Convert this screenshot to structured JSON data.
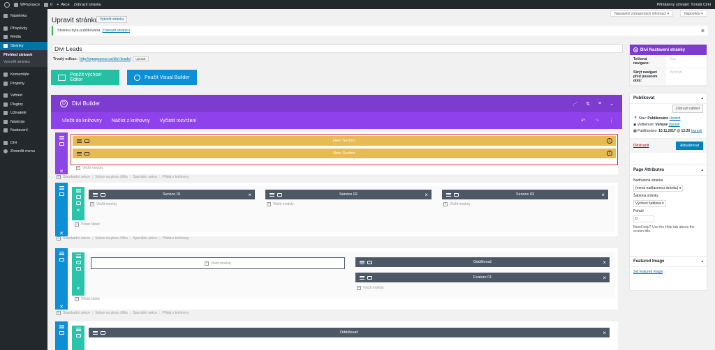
{
  "adminbar": {
    "site_name": "WPspravce",
    "comments_count": "0",
    "new_label": "Akce",
    "view_page": "Zobrazit stránku",
    "user_greeting": "Přihlášený uživatel: Tomáš Cirkl"
  },
  "sidebar": {
    "items": [
      {
        "label": "Nástěnka",
        "icon": "dashboard-icon"
      },
      {
        "label": "Příspěvky",
        "icon": "pin-icon"
      },
      {
        "label": "Média",
        "icon": "media-icon"
      },
      {
        "label": "Stránky",
        "icon": "pages-icon",
        "active": true
      },
      {
        "label": "Komentáře",
        "icon": "comments-icon"
      },
      {
        "label": "Projekty",
        "icon": "pin-icon"
      },
      {
        "label": "Vzhled",
        "icon": "brush-icon"
      },
      {
        "label": "Pluginy",
        "icon": "plugin-icon"
      },
      {
        "label": "Uživatelé",
        "icon": "users-icon"
      },
      {
        "label": "Nástroje",
        "icon": "tools-icon"
      },
      {
        "label": "Nastavení",
        "icon": "settings-icon"
      },
      {
        "label": "Divi",
        "icon": "divi-icon"
      }
    ],
    "sub_items": [
      "Přehled stránek",
      "Vytvořit stránku"
    ],
    "collapse": "Zmenšit menu"
  },
  "header": {
    "screen_options": "Nastavení zobrazených informací",
    "help": "Nápověda",
    "title": "Upravit stránku",
    "add_new": "Vytvořit stránku"
  },
  "notice": {
    "text": "Stránka byla publikována.",
    "link": "Zobrazit stránku"
  },
  "post": {
    "title": "Divi Leads",
    "permalink_label": "Trvalý odkaz:",
    "permalink_url": "http://wpspravce.cz/divi-leads/",
    "permalink_edit": "Upravit",
    "default_editor": "Použít výchozí Editor",
    "visual_builder": "Použít Visual Builder"
  },
  "builder": {
    "title": "Divi Builder",
    "logo": "D",
    "toolbar": [
      "Uložit do knihovny",
      "Načíst z knihovny",
      "Vyčistit rozvržení"
    ],
    "section_links": [
      "Standardní sekce",
      "Sekce na plnou šířku",
      "Speciální sekce",
      "Přidat z knihovny"
    ],
    "add_module": "Vložit moduly",
    "add_row": "Přidat řádek",
    "hero_modules": [
      {
        "label": "Hero Section",
        "number": "1"
      },
      {
        "label": "Hero Section",
        "number": "2"
      }
    ],
    "service_modules": [
      "Service 01",
      "Service 02",
      "Service 03"
    ],
    "divider_module": "Oddělovač",
    "feature_module": "Feature 01",
    "bottom_module": "Oddělovač",
    "colors": {
      "header": "#7e3bd0",
      "toolbar": "#8f42ec",
      "fullwidth": "#8e45e5",
      "section": "#0c8fd6",
      "row": "#29c4a9",
      "hero": "#e6bb56",
      "module": "#4c5866"
    }
  },
  "divi_settings": {
    "title": "Divi Nastavení stránky",
    "rows": [
      {
        "key": "Tečková navigace:",
        "value": "Vyp."
      },
      {
        "key": "Skrýt navigaci před posunem dolů:",
        "value": "Výchozí"
      }
    ]
  },
  "publish": {
    "title": "Publikovat",
    "preview": "Zobrazit náhled",
    "status_label": "Stav:",
    "status_value": "Publikováno",
    "status_edit": "Upravit",
    "visibility_label": "Viditelnost:",
    "visibility_value": "Veřejné",
    "visibility_edit": "Upravit",
    "published_label": "Publikováno:",
    "published_value": "10.11.2017 @ 12:20",
    "published_edit": "Upravit",
    "trash": "Odstranit",
    "update": "Aktualizovat"
  },
  "page_attributes": {
    "title": "Page Attributes",
    "parent_label": "Nadřazená stránka",
    "parent_value": "(nemá nadřazenou stránku)",
    "template_label": "Šablona stránky",
    "template_value": "Výchozí šablona",
    "order_label": "Pořadí",
    "order_value": "0",
    "help": "Need help? Use the Help tab above the screen title."
  },
  "featured_image": {
    "title": "Featured Image",
    "link": "Set featured image"
  }
}
